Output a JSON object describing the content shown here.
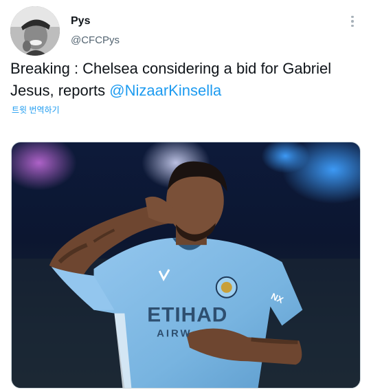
{
  "author": {
    "display_name": "Pys",
    "handle": "@CFCPys"
  },
  "tweet": {
    "text_before_mention": "Breaking : Chelsea considering a bid for Gabriel Jesus, reports ",
    "mention": "@NizaarKinsella",
    "translate_label": "트윗 번역하기"
  },
  "media": {
    "shirt_sponsor": "ETIHAD",
    "shirt_sponsor_sub": "AIRW",
    "sleeve_text": "NX"
  },
  "colors": {
    "link": "#1d9bf0",
    "secondary_text": "#536471",
    "kit_sky_blue": "#7fb7e3"
  }
}
